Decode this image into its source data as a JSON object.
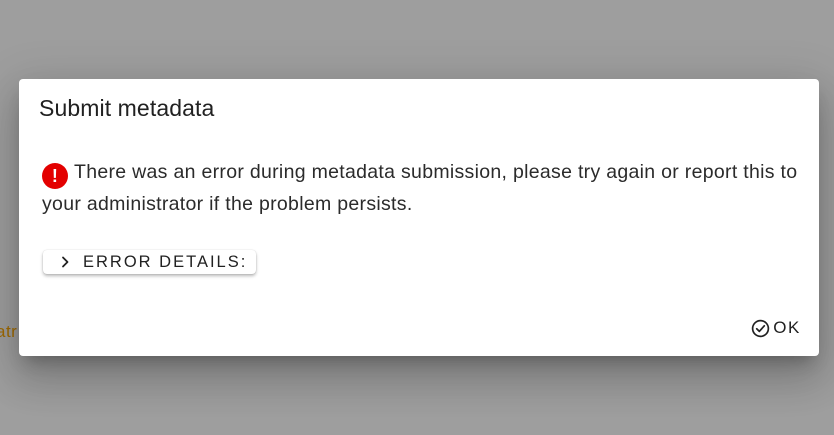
{
  "background": {
    "fragment_text": "atr",
    "color": "#9e9e9e"
  },
  "dialog": {
    "title": "Submit metadata",
    "error_icon_glyph": "!",
    "message": "There was an error during metadata submission, please try again or report this to your administrator if the problem persists.",
    "details_button": {
      "label": "ERROR DETAILS:",
      "icon": "chevron-right-icon"
    },
    "ok_button": {
      "label": "OK",
      "icon": "check-circle-icon"
    },
    "colors": {
      "error": "#e30000",
      "text": "#212121"
    }
  }
}
